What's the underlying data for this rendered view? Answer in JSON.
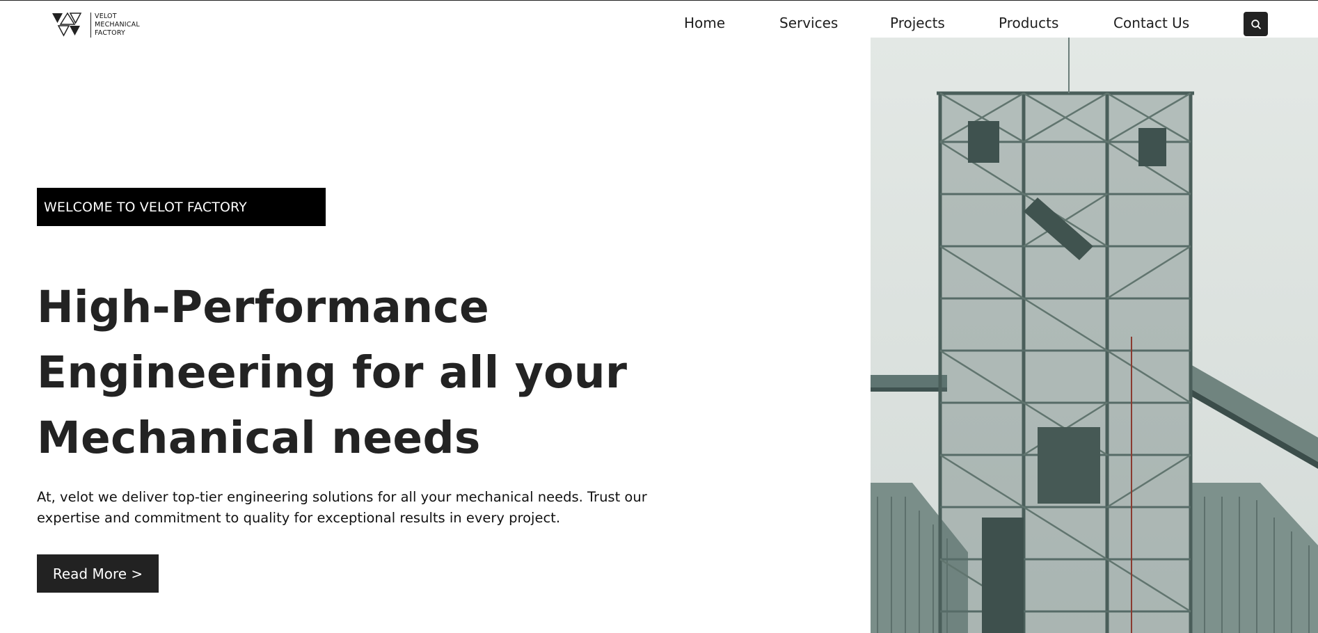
{
  "brand": {
    "logo_icon": "triangles-logo-icon",
    "lines": [
      "VELOT",
      "MECHANICAL",
      "FACTORY"
    ]
  },
  "nav": {
    "items": [
      {
        "label": "Home"
      },
      {
        "label": "Services"
      },
      {
        "label": "Projects"
      },
      {
        "label": "Products"
      },
      {
        "label": "Contact Us"
      }
    ],
    "search_icon": "search-icon"
  },
  "hero": {
    "badge": "WELCOME TO VELOT FACTORY",
    "title_lines": [
      "High-Performance",
      "Engineering for all your",
      "Mechanical needs"
    ],
    "description_lines": [
      "At, velot we deliver top-tier engineering solutions for all your mechanical needs. Trust our",
      "expertise and commitment to quality for exceptional results in every project."
    ],
    "cta_label": "Read More >",
    "image_icon": "industrial-tower-photo"
  },
  "colors": {
    "background": "#ffffff",
    "text_dark": "#232323",
    "badge_bg": "#000000",
    "button_bg": "#222222",
    "button_text": "#ffffff"
  }
}
